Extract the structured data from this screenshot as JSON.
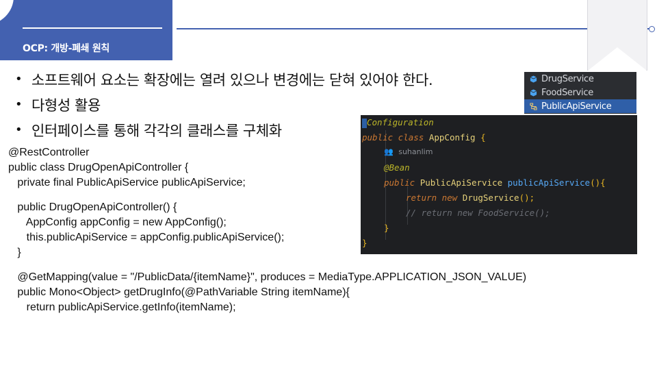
{
  "header": {
    "title": "OCP: 개방-폐쇄 원칙",
    "accent_color": "#4361b0"
  },
  "bullets": [
    "소프트웨어 요소는 확장에는 열려 있으나 변경에는 닫혀 있어야 한다.",
    "다형성 활용",
    "인터페이스를 통해 각각의 클래스를 구체화"
  ],
  "code_lines": [
    "@RestController",
    "public class DrugOpenApiController {",
    "   private final PublicApiService publicApiService;",
    "",
    "   public DrugOpenApiController() {",
    "      AppConfig appConfig = new AppConfig();",
    "      this.publicApiService = appConfig.publicApiService();",
    "   }",
    "",
    "   @GetMapping(value = \"/PublicData/{itemName}\", produces = MediaType.APPLICATION_JSON_VALUE)",
    "   public Mono<Object> getDrugInfo(@PathVariable String itemName){",
    "      return publicApiService.getInfo(itemName);"
  ],
  "service_list": {
    "items": [
      {
        "label": "DrugService",
        "icon": "interface-icon"
      },
      {
        "label": "FoodService",
        "icon": "interface-icon"
      },
      {
        "label": "PublicApiService",
        "icon": "implementation-hierarchy-icon",
        "selected": true
      }
    ]
  },
  "ide": {
    "annotation": "Configuration",
    "class_kw": "public class",
    "class_name": "AppConfig",
    "open_brace": "{",
    "author": "suhanlim",
    "bean": "@Bean",
    "method_kw": "public",
    "return_type": "PublicApiService",
    "method_name": "publicApiService",
    "method_tail": "(){",
    "return_kw": "return new",
    "return_type2": "DrugService",
    "return_tail": "();",
    "comment": "// return new FoodService();",
    "inner_close": "}",
    "outer_close": "}"
  }
}
